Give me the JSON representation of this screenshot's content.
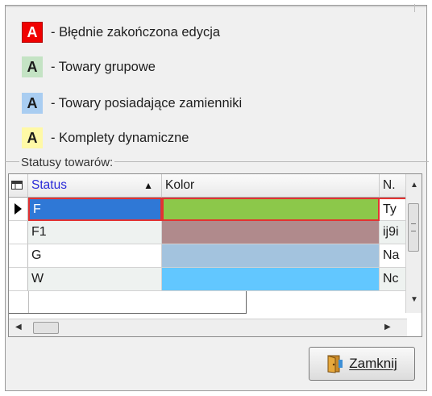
{
  "legend": [
    {
      "letter": "A",
      "text": "- Błędnie zakończona edycja",
      "bg": "#f00000",
      "fg": "#ffffff",
      "border": "#b00000"
    },
    {
      "letter": "A",
      "text": "- Towary grupowe",
      "bg": "#c4e3c4",
      "fg": "#000000",
      "border": "#c4e3c4"
    },
    {
      "letter": "A",
      "text": "- Towary posiadające zamienniki",
      "bg": "#a9cdf1",
      "fg": "#000000",
      "border": "#a9cdf1"
    },
    {
      "letter": "A",
      "text": "- Komplety dynamiczne",
      "bg": "#fff9a6",
      "fg": "#000000",
      "border": "#fff9a6"
    }
  ],
  "group_label": "Statusy towarów:",
  "grid": {
    "columns": {
      "status": "Status",
      "kolor": "Kolor",
      "n": "N."
    },
    "sort_indicator": "▲",
    "rows": [
      {
        "status": "F",
        "kolor": "#8cc84a",
        "n": "Ty",
        "selected": true
      },
      {
        "status": "F1",
        "kolor": "#b08a8c",
        "n": "ij9i",
        "selected": false
      },
      {
        "status": "G",
        "kolor": "#a3c3de",
        "n": "Na",
        "selected": false
      },
      {
        "status": "W",
        "kolor": "#62c7ff",
        "n": "Nc",
        "selected": false
      }
    ]
  },
  "close_button": {
    "label": "Zamknij"
  },
  "colors": {
    "status_header": "#2a2ad8",
    "selection": "#2f78d6",
    "error_outline": "#e33232"
  }
}
